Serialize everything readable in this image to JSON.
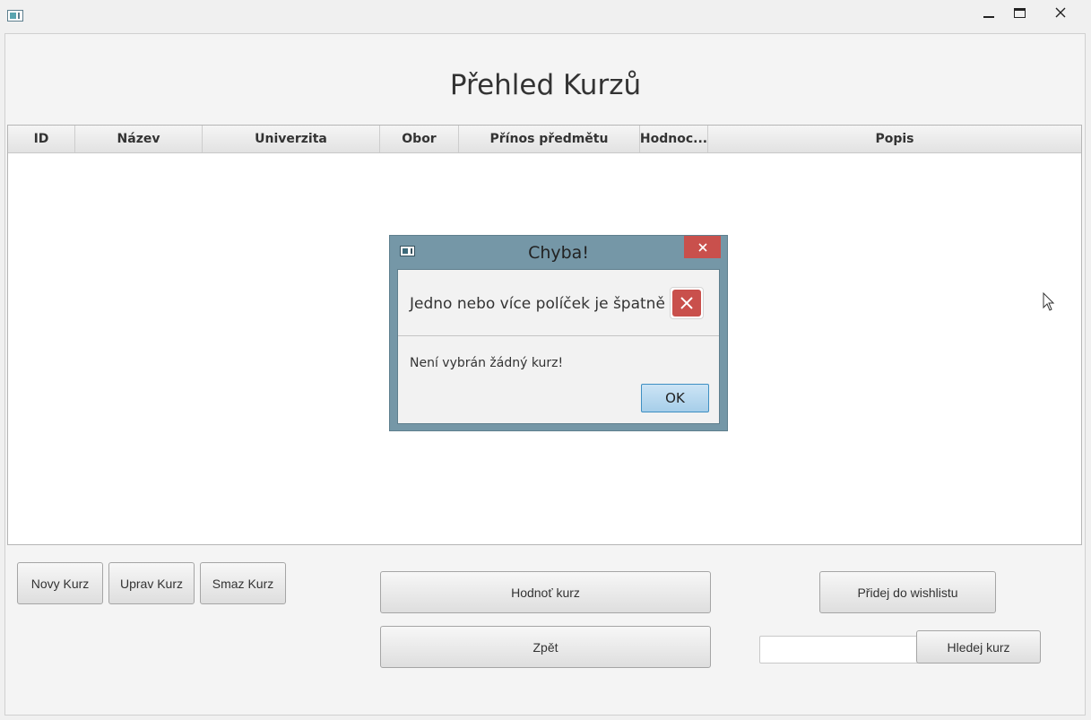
{
  "window": {
    "title": ""
  },
  "page": {
    "title": "Přehled Kurzů"
  },
  "table": {
    "columns": [
      "ID",
      "Název",
      "Univerzita",
      "Obor",
      "Přínos předmětu",
      "Hodnoc...",
      "Popis"
    ],
    "rows": []
  },
  "buttons": {
    "new_course": "Novy Kurz",
    "edit_course": "Uprav Kurz",
    "delete_course": "Smaz Kurz",
    "rate_course": "Hodnoť kurz",
    "back": "Zpět",
    "add_wishlist": "Přidej do wishlistu",
    "search": "Hledej kurz"
  },
  "search": {
    "value": ""
  },
  "dialog": {
    "title": "Chyba!",
    "header": "Jedno nebo více políček je špatně",
    "message": "Není vybrán žádný kurz!",
    "ok": "OK"
  },
  "colors": {
    "dialog_frame": "#7597a7",
    "close_red": "#c9504c",
    "ok_blue": "#a6cee9"
  },
  "icons": [
    "app-icon",
    "minimize-icon",
    "maximize-icon",
    "close-icon",
    "error-icon",
    "mouse-cursor-icon"
  ]
}
